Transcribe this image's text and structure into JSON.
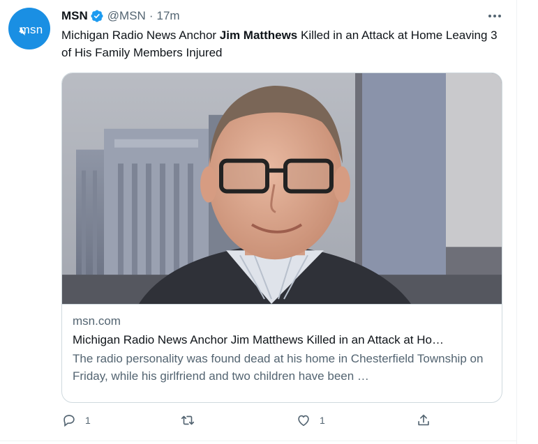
{
  "tweet": {
    "display_name": "MSN",
    "handle": "@MSN",
    "separator": "·",
    "time": "17m",
    "avatar_text": "msn",
    "text_before": "Michigan Radio News Anchor ",
    "text_bold": "Jim Matthews",
    "text_after": " Killed in an Attack at Home Leaving 3 of His Family Members Injured"
  },
  "card": {
    "domain": "msn.com",
    "title": "Michigan Radio News Anchor Jim Matthews Killed in an Attack at Ho…",
    "description": "The radio personality was found dead at his home in Chesterfield Township on Friday, while his girlfriend and two children have been …"
  },
  "actions": {
    "reply_count": "1",
    "retweet_count": "",
    "like_count": "1"
  },
  "colors": {
    "brand_blue": "#1d9bf0",
    "avatar_blue": "#1a8fe3",
    "secondary_text": "#536471",
    "primary_text": "#0f1419",
    "border": "#cfd9de"
  },
  "icons": [
    "verified-badge-icon",
    "more-dots-icon",
    "reply-icon",
    "retweet-icon",
    "like-icon",
    "share-icon"
  ]
}
